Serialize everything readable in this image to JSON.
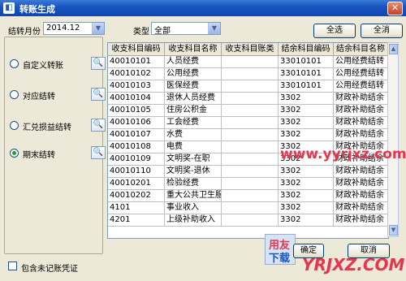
{
  "window": {
    "title": "转账生成",
    "close_glyph": "✕"
  },
  "filters": {
    "month_label": "结转月份",
    "month_value": "2014.12",
    "type_label": "类型",
    "type_value": "全部"
  },
  "buttons": {
    "select_all": "全选",
    "clear_all": "全消",
    "ok": "确定",
    "cancel": "取消"
  },
  "options": [
    {
      "label": "自定义转账",
      "selected": false
    },
    {
      "label": "对应结转",
      "selected": false
    },
    {
      "label": "汇兑损益结转",
      "selected": false
    },
    {
      "label": "期末结转",
      "selected": true
    }
  ],
  "grid": {
    "columns": [
      "收支科目编码",
      "收支科目名称",
      "收支科目账类",
      "结余科目编码",
      "结余科目名称"
    ],
    "rows": [
      [
        "40010101",
        "人员经费",
        "",
        "33010101",
        "公用经费结转"
      ],
      [
        "40010102",
        "公用经费",
        "",
        "33010101",
        "公用经费结转"
      ],
      [
        "40010103",
        "医保经费",
        "",
        "33010101",
        "公用经费结转"
      ],
      [
        "40010104",
        "退休人员经费",
        "",
        "3302",
        "财政补助结余"
      ],
      [
        "40010105",
        "住房公积金",
        "",
        "3302",
        "财政补助结余"
      ],
      [
        "40010106",
        "工会经费",
        "",
        "3302",
        "财政补助结余"
      ],
      [
        "40010107",
        "水费",
        "",
        "3302",
        "财政补助结余"
      ],
      [
        "40010108",
        "电费",
        "",
        "3302",
        "财政补助结余"
      ],
      [
        "40010109",
        "文明奖-在职",
        "",
        "3302",
        "财政补助结余"
      ],
      [
        "40010110",
        "文明奖-退休",
        "",
        "3302",
        "财政补助结余"
      ],
      [
        "40010201",
        "检验经费",
        "",
        "3302",
        "财政补助结余"
      ],
      [
        "40010202",
        "重大公共卫生服务",
        "",
        "3302",
        "财政补助结余"
      ],
      [
        "4101",
        "事业收入",
        "",
        "3302",
        "财政补助结余"
      ],
      [
        "4201",
        "上级补助收入",
        "",
        "3302",
        "财政补助结余"
      ]
    ]
  },
  "footer": {
    "include_unposted_label": "包含未记账凭证"
  },
  "watermarks": {
    "site_url": "www.yyrjxz.com",
    "logo_left": "用友",
    "logo_left2": "下载",
    "logo_right": "YRJXZ.COM"
  },
  "icons": {
    "combo_arrow": "▼",
    "scroll_up": "▲",
    "scroll_down": "▼",
    "magnifier": "🔍"
  }
}
